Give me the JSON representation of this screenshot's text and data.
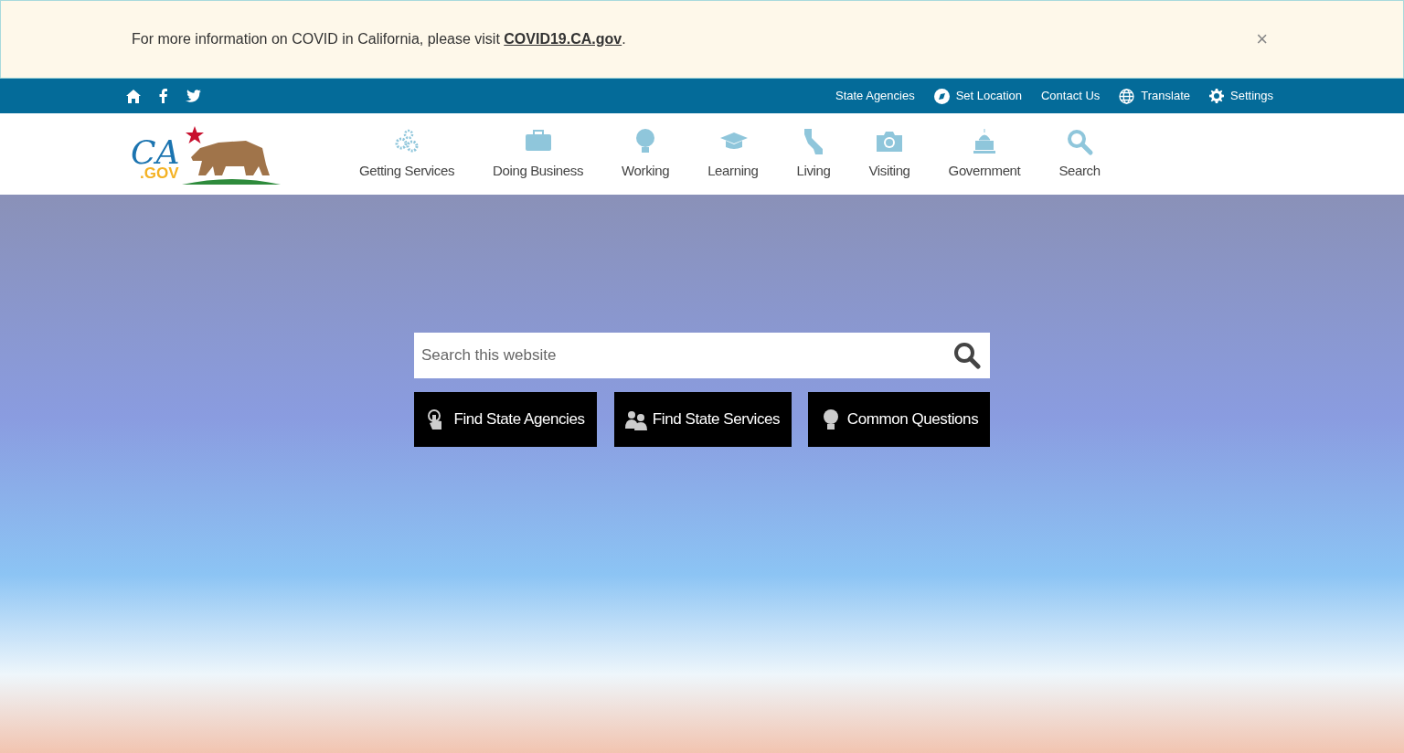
{
  "alert": {
    "text": "For more information on COVID in California, please visit **COVID19.CA.gov**.",
    "close": "×"
  },
  "utility_bar": {
    "social": [
      {
        "kind": "home"
      },
      {
        "kind": "facebook"
      },
      {
        "kind": "twitter"
      }
    ],
    "links": [
      {
        "kind": "plain",
        "label": "State Agencies"
      },
      {
        "kind": "location",
        "label": "Set Location"
      },
      {
        "kind": "plain",
        "label": "Contact Us"
      },
      {
        "kind": "globe",
        "label": "Translate"
      },
      {
        "kind": "gear",
        "label": "Settings"
      }
    ]
  },
  "logo": {
    "letters": "CA",
    "domain": ".GOV"
  },
  "nav": [
    {
      "kind": "gears",
      "label": "Getting Services"
    },
    {
      "kind": "briefcase",
      "label": "Doing Business"
    },
    {
      "kind": "bulb",
      "label": "Working"
    },
    {
      "kind": "cap",
      "label": "Learning"
    },
    {
      "kind": "state",
      "label": "Living"
    },
    {
      "kind": "camera",
      "label": "Visiting"
    },
    {
      "kind": "capitol",
      "label": "Government"
    },
    {
      "kind": "search",
      "label": "Search"
    }
  ],
  "search": {
    "placeholder": "Search this website"
  },
  "actions": [
    {
      "kind": "pointer",
      "label": "Find State Agencies"
    },
    {
      "kind": "people",
      "label": "Find State Services"
    },
    {
      "kind": "bulb",
      "label": "Common Questions"
    }
  ]
}
